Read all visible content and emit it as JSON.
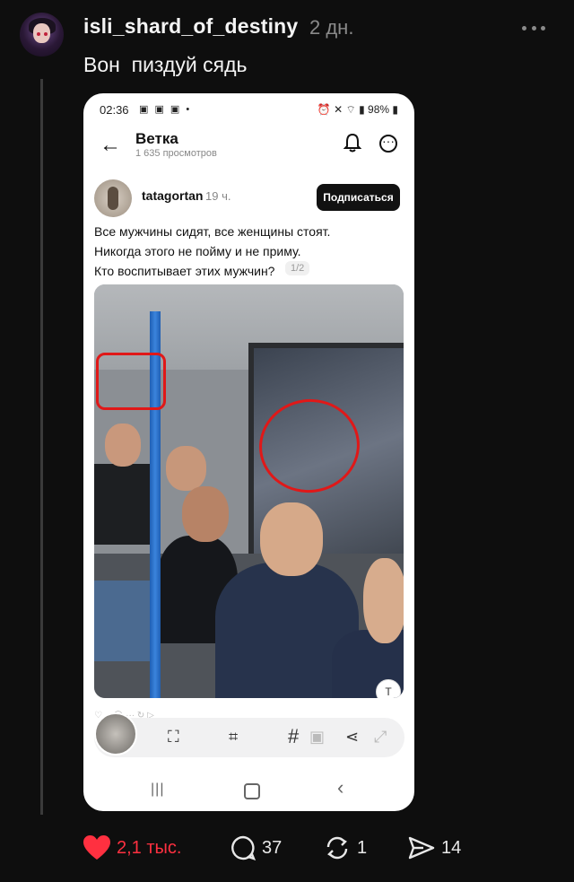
{
  "post": {
    "username": "isli_shard_of_destiny",
    "timestamp": "2 дн.",
    "text": "Вон  пиздуй сядь"
  },
  "screenshot": {
    "status_bar": {
      "time": "02:36",
      "battery": "98%"
    },
    "header": {
      "title": "Ветка",
      "views": "1 635 просмотров"
    },
    "inner_post": {
      "author": "tatagortan",
      "time": "19 ч.",
      "follow_label": "Подписаться",
      "lines": [
        "Все мужчины сидят, все женщины стоят.",
        "Никогда этого не пойму и не приму.",
        "Кто воспитывает этих мужчин?"
      ],
      "page_indicator": "1/2"
    }
  },
  "actions": {
    "likes": "2,1 тыс.",
    "comments": "37",
    "reposts": "1",
    "shares": "14"
  },
  "colors": {
    "background": "#0e0e0e",
    "like": "#ff3040",
    "annotation_red": "#e01818"
  }
}
